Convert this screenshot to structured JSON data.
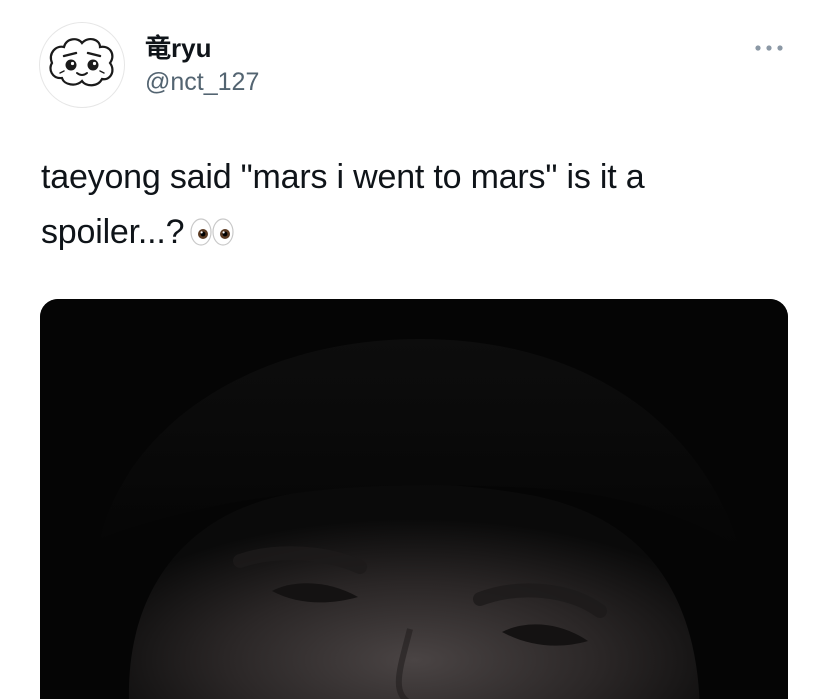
{
  "tweet": {
    "author": {
      "display_name": "竜ryu",
      "handle": "@nct_127",
      "avatar_icon": "cartoon-face-icon"
    },
    "more_icon": "more-dots-icon",
    "text_part1": "taeyong said \"mars i went to mars\" is it a",
    "text_part2": "spoiler...?",
    "emoji_icon": "eyes-icon",
    "media": {
      "type": "video-still",
      "icon": "video-frame"
    }
  },
  "colors": {
    "text_primary": "#0f1419",
    "text_secondary": "#536471",
    "media_background": "#050505"
  }
}
